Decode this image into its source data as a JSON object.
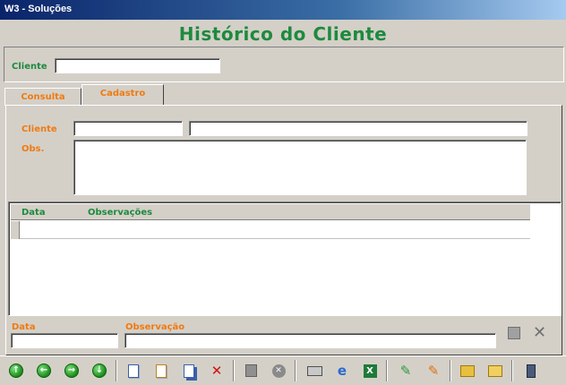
{
  "window": {
    "title": "W3 - Soluções"
  },
  "page": {
    "title": "Histórico do Cliente"
  },
  "header": {
    "cliente_label": "Cliente",
    "cliente_value": ""
  },
  "tabs": [
    {
      "label": "Consulta",
      "active": false
    },
    {
      "label": "Cadastro",
      "active": true
    }
  ],
  "form": {
    "cliente_label": "Cliente",
    "cliente_code": "",
    "cliente_name": "",
    "obs_label": "Obs.",
    "obs_value": ""
  },
  "grid": {
    "columns": [
      "Data",
      "Observações"
    ],
    "rows": []
  },
  "editor": {
    "data_label": "Data",
    "data_value": "",
    "observacao_label": "Observação",
    "observacao_value": ""
  },
  "colors": {
    "title_green": "#1e8a3e",
    "label_orange": "#f07a10",
    "window_bg": "#d4d0c8"
  },
  "toolbar": {
    "icons": [
      "first-record-icon",
      "previous-record-icon",
      "next-record-icon",
      "last-record-icon",
      "new-icon",
      "copy-icon",
      "duplicate-icon",
      "delete-icon",
      "save-icon",
      "cancel-icon",
      "print-icon",
      "preview-icon",
      "excel-icon",
      "tool-1-icon",
      "tool-2-icon",
      "export-icon",
      "open-icon",
      "exit-icon"
    ]
  }
}
